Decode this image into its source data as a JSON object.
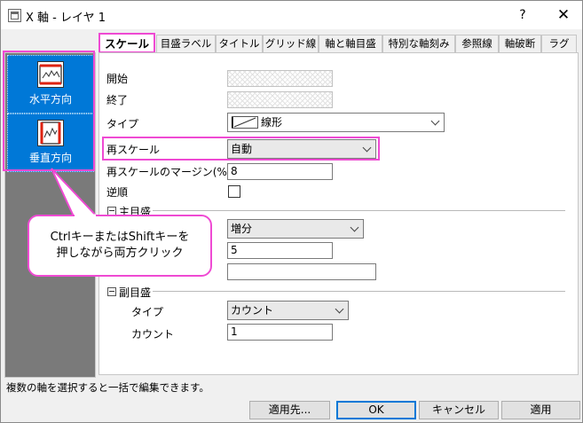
{
  "title": "X 軸 - レイヤ 1",
  "titlebar": {
    "help": "?",
    "close": "✕"
  },
  "left_panel": {
    "items": [
      {
        "label": "水平方向",
        "icon": "horizontal-axis-icon"
      },
      {
        "label": "垂直方向",
        "icon": "vertical-axis-icon"
      }
    ]
  },
  "tabs": [
    "スケール",
    "目盛ラベル",
    "タイトル",
    "グリッド線",
    "軸と軸目盛",
    "特別な軸刻み",
    "参照線",
    "軸破断",
    "ラグ"
  ],
  "scale": {
    "start_label": "開始",
    "end_label": "終了",
    "type_label": "タイプ",
    "type_value": "線形",
    "rescale_label": "再スケール",
    "rescale_value": "自動",
    "margin_label": "再スケールのマージン(%)",
    "margin_value": "8",
    "reverse_label": "逆順",
    "major_group": "主目盛",
    "major_type_value": "増分",
    "major_value": "5",
    "minor_group": "副目盛",
    "minor_type_label": "タイプ",
    "minor_type_value": "カウント",
    "minor_count_label": "カウント",
    "minor_count_value": "1"
  },
  "callout": {
    "line1": "CtrlキーまたはShiftキーを",
    "line2": "押しながら両方クリック"
  },
  "status": "複数の軸を選択すると一括で編集できます。",
  "buttons": {
    "apply_to": "適用先...",
    "ok": "OK",
    "cancel": "キャンセル",
    "apply": "適用"
  },
  "colors": {
    "accent": "#ef4ad3",
    "selection": "#0078d7"
  }
}
